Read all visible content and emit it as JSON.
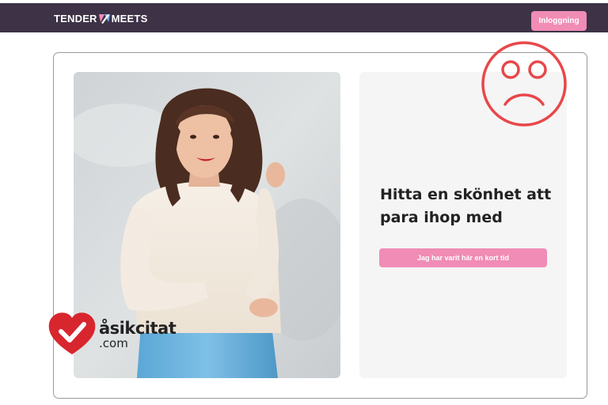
{
  "header": {
    "logo_left": "TENDER",
    "logo_right": "MEETS",
    "login_label": "Inloggning"
  },
  "hero": {
    "headline": "Hitta en skönhet att para ihop med",
    "cta_label": "Jag har varit här en kort tid"
  },
  "watermark": {
    "line1": "åsikcitat",
    "line2": ".com"
  },
  "colors": {
    "header_bg": "#3d3246",
    "accent_pink": "#f08cb5",
    "sad_face_red": "#e8474a",
    "watermark_heart": "#d8262f"
  },
  "icons": [
    "logo-heart-icon",
    "sad-face-icon",
    "heart-check-icon"
  ]
}
